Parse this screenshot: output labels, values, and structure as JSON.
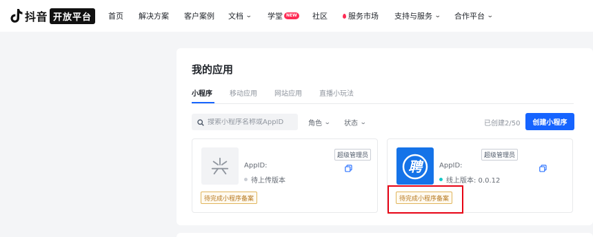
{
  "brand": {
    "name": "抖音",
    "badge": "开放平台"
  },
  "nav": {
    "items": [
      {
        "label": "首页"
      },
      {
        "label": "解决方案"
      },
      {
        "label": "客户案例"
      },
      {
        "label": "文档",
        "chevron": "⌄"
      },
      {
        "label": "学堂",
        "badge": "NEW"
      },
      {
        "label": "社区"
      },
      {
        "label": "服务市场"
      },
      {
        "label": "支持与服务",
        "chevron": "⌄"
      },
      {
        "label": "合作平台",
        "chevron": "⌄"
      }
    ]
  },
  "main": {
    "title": "我的应用",
    "tabs": [
      {
        "label": "小程序",
        "active": true
      },
      {
        "label": "移动应用"
      },
      {
        "label": "网站应用"
      },
      {
        "label": "直播小玩法"
      }
    ],
    "search": {
      "placeholder": "搜索小程序名称或AppID"
    },
    "filters": {
      "role": "角色",
      "status": "状态"
    },
    "created_count": "已创建2/50",
    "create_button": "创建小程序"
  },
  "apps": [
    {
      "name": "",
      "appid_label": "AppID:",
      "version": "待上传版本",
      "version_dot_color": "#c9cdd4",
      "role": "超级管理员",
      "filing": "待完成小程序备案",
      "icon": "placeholder-icon"
    },
    {
      "name": "",
      "appid_label": "AppID:",
      "version": "线上版本: 0.0.12",
      "version_dot_color": "#14c9c9",
      "role": "超级管理员",
      "filing": "待完成小程序备案",
      "icon": "pin-logo",
      "icon_glyph": "聘"
    }
  ],
  "colors": {
    "accent": "#1664ff",
    "highlight": "#e60012",
    "brand_red": "#fe2c55"
  }
}
